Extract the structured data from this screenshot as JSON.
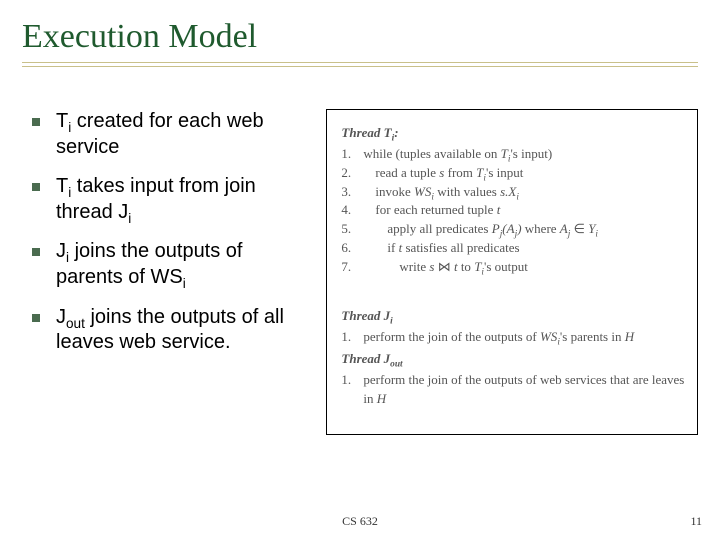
{
  "title": "Execution Model",
  "bullets": [
    {
      "html": "T<sub>i</sub> created for each web service"
    },
    {
      "html": "T<sub>i</sub> takes input from join thread J<sub>i</sub>"
    },
    {
      "html": "J<sub>i</sub> joins the outputs of parents of WS<sub>i</sub>"
    },
    {
      "html": "J<sub>out</sub> joins the outputs of all leaves web service."
    }
  ],
  "figure": {
    "thread_t_label_html": "Thread <span class='mathit'>T<sub>i</sub></span>:",
    "t_steps": [
      {
        "n": "1.",
        "indent": 0,
        "html": "while (tuples available on <span class='mathit'>T<sub>i</sub></span>'s input)"
      },
      {
        "n": "2.",
        "indent": 1,
        "html": "read a tuple <span class='mathit'>s</span> from <span class='mathit'>T<sub>i</sub></span>'s input"
      },
      {
        "n": "3.",
        "indent": 1,
        "html": "invoke <span class='mathit'>WS<sub>i</sub></span> with values <span class='mathit'>s.X<sub>i</sub></span>"
      },
      {
        "n": "4.",
        "indent": 1,
        "html": "for each returned tuple <span class='mathit'>t</span>"
      },
      {
        "n": "5.",
        "indent": 2,
        "html": "apply all predicates <span class='mathit'>P<sub>j</sub>(A<sub>j</sub>)</span> where <span class='mathit'>A<sub>j</sub></span> ∈ <span class='scr-y mathit'>Y<sub>i</sub></span>"
      },
      {
        "n": "6.",
        "indent": 2,
        "html": "if <span class='mathit'>t</span> satisfies all predicates"
      },
      {
        "n": "7.",
        "indent": 3,
        "html": "write <span class='mathit'>s</span> ⋈ <span class='mathit'>t</span> to <span class='mathit'>T<sub>i</sub></span>'s output"
      }
    ],
    "thread_j_label_html": "Thread <span class='mathit'>J<sub>i</sub></span>",
    "j_steps": [
      {
        "n": "1.",
        "indent": 0,
        "html": "perform the join of the outputs of <span class='mathit'>WS<sub>i</sub></span>'s parents in <span class='mathit'>H</span>"
      }
    ],
    "thread_jout_label_html": "Thread <span class='mathit'>J<sub>out</sub></span>",
    "jout_steps": [
      {
        "n": "1.",
        "indent": 0,
        "html": "perform the join of the outputs of web services that are leaves in <span class='mathit'>H</span>"
      }
    ]
  },
  "footer": {
    "center": "CS 632",
    "right": "11"
  }
}
